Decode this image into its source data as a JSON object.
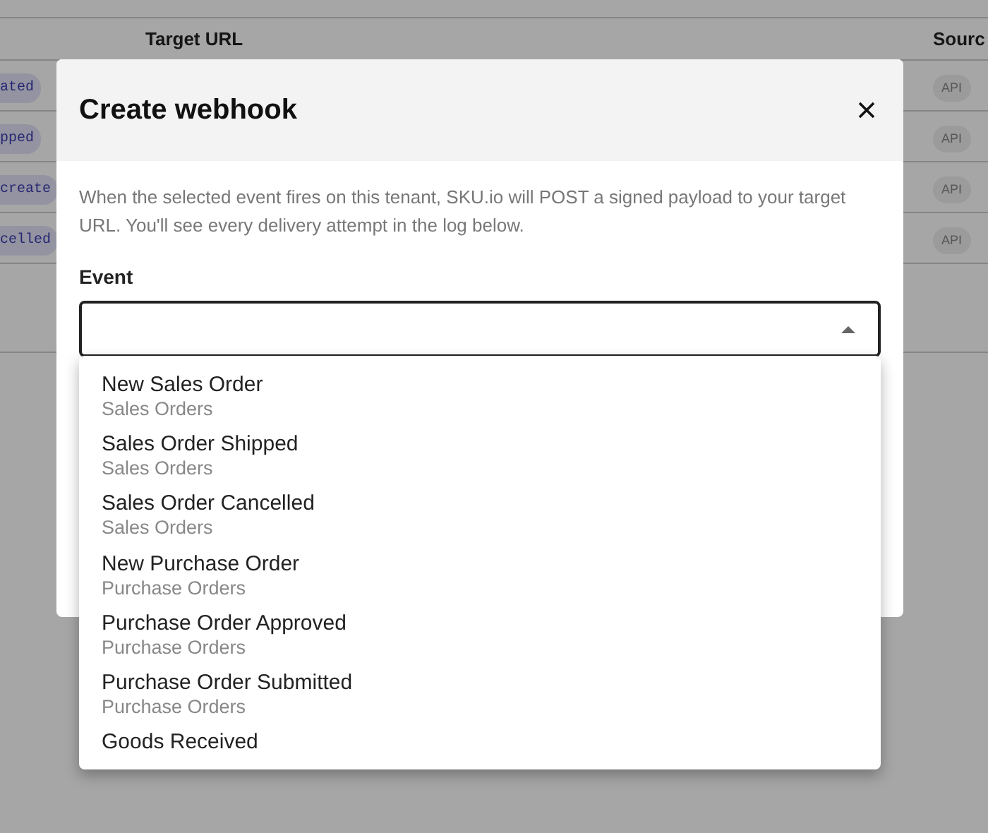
{
  "background_table": {
    "columns": [
      {
        "label": "Target URL"
      },
      {
        "label": "Sourc"
      }
    ],
    "rows": [
      {
        "event": "ated",
        "source": "API"
      },
      {
        "event": "pped",
        "source": "API"
      },
      {
        "event": "create",
        "source": "API"
      },
      {
        "event": "celled",
        "source": "API"
      }
    ]
  },
  "dialog": {
    "title": "Create webhook",
    "description": "When the selected event fires on this tenant, SKU.io will POST a signed payload to your target URL. You'll see every delivery attempt in the log below.",
    "event_field": {
      "label": "Event",
      "expanded": true,
      "options": [
        {
          "label": "New Sales Order",
          "group": "Sales Orders"
        },
        {
          "label": "Sales Order Shipped",
          "group": "Sales Orders"
        },
        {
          "label": "Sales Order Cancelled",
          "group": "Sales Orders"
        },
        {
          "label": "New Purchase Order",
          "group": "Purchase Orders"
        },
        {
          "label": "Purchase Order Approved",
          "group": "Purchase Orders"
        },
        {
          "label": "Purchase Order Submitted",
          "group": "Purchase Orders"
        },
        {
          "label": "Goods Received"
        }
      ]
    }
  }
}
